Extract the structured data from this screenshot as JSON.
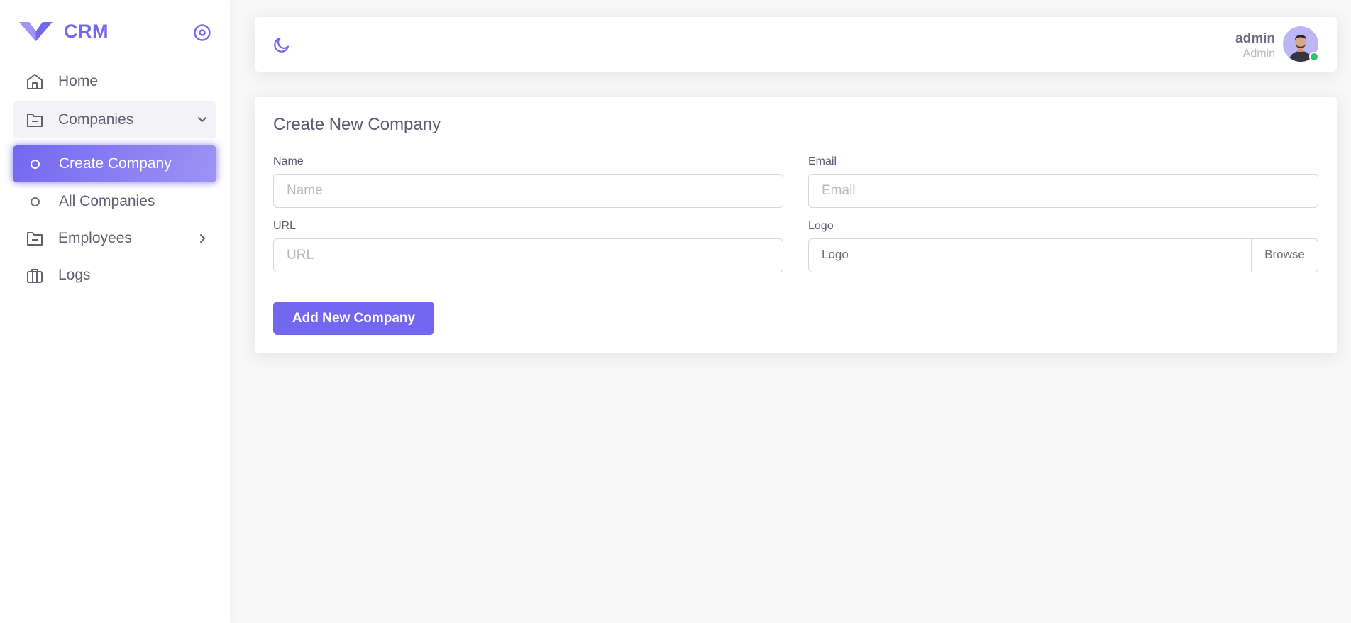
{
  "app": {
    "name": "CRM",
    "accent_color": "#7367f0"
  },
  "sidebar": {
    "items": [
      {
        "label": "Home",
        "icon": "home-icon"
      },
      {
        "label": "Companies",
        "icon": "folder-icon",
        "expanded": true
      },
      {
        "label": "Employees",
        "icon": "folder-icon",
        "expanded": false
      },
      {
        "label": "Logs",
        "icon": "briefcase-icon"
      }
    ],
    "companies_children": [
      {
        "label": "Create Company",
        "active": true
      },
      {
        "label": "All Companies",
        "active": false
      }
    ]
  },
  "navbar": {
    "user_name": "admin",
    "user_role": "Admin",
    "status": "online"
  },
  "form": {
    "title": "Create New Company",
    "name": {
      "label": "Name",
      "placeholder": "Name",
      "value": ""
    },
    "email": {
      "label": "Email",
      "placeholder": "Email",
      "value": ""
    },
    "url": {
      "label": "URL",
      "placeholder": "URL",
      "value": ""
    },
    "logo": {
      "label": "Logo",
      "text": "Logo",
      "browse": "Browse"
    },
    "submit_label": "Add New Company"
  }
}
